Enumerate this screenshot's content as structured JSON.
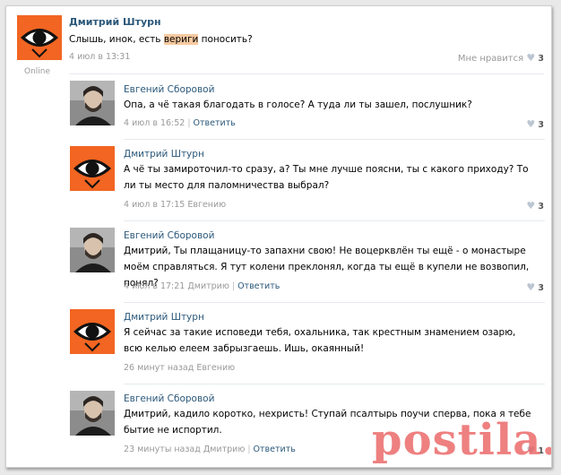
{
  "main_post": {
    "author": "Дмитрий Штурн",
    "status": "Online",
    "text_before": "Слышь, инок, есть ",
    "text_highlight": "вериги",
    "text_after": " поносить?",
    "timestamp": "4 июл в 13:31",
    "like_label": "Мне нравится",
    "likes": "3",
    "avatar_icon": "eye-logo-icon"
  },
  "comments": [
    {
      "author": "Евгений Сборовой",
      "text": "Опа, а чё такая благодать в голосе? А туда ли ты зашел, послушник?",
      "timestamp": "4 июл в 16:52",
      "reply_to": "",
      "reply_label": "Ответить",
      "likes": "3"
    },
    {
      "author": "Дмитрий Штурн",
      "text": "А чё ты замироточил-то сразу, а? Ты мне лучше поясни, ты с какого приходу? То ли ты место для паломничества выбрал?",
      "timestamp": "4 июл в 17:15",
      "reply_to": "Евгению",
      "reply_label": "",
      "likes": "3"
    },
    {
      "author": "Евгений Сборовой",
      "text": "Дмитрий, Ты плащаницу-то запахни свою! Не воцерквлён ты ещё - о монастыре моём справляться. Я тут колени преклонял, когда ты ещё в купели не возвопил, понял?",
      "timestamp": "4 июл в 17:21",
      "reply_to": "Дмитрию",
      "reply_label": "Ответить",
      "likes": "3"
    },
    {
      "author": "Дмитрий Штурн",
      "text": "Я сейчас за такие исповеди тебя, охальника, так крестным знамением озарю, всю келью елеем забрызгаешь. Ишь, окаянный!",
      "timestamp": "26 минут назад",
      "reply_to": "Евгению",
      "reply_label": "",
      "likes": ""
    },
    {
      "author": "Евгений Сборовой",
      "text": "Дмитрий, кадило коротко, нехристь! Ступай псалтырь поучи сперва, пока я тебе бытие не испортил.",
      "timestamp": "23 минуты назад",
      "reply_to": "Дмитрию",
      "reply_label": "Ответить",
      "likes": "1"
    }
  ],
  "watermark": "postila.ru",
  "colors": {
    "link": "#2b587a",
    "avatar_orange": "#f26522",
    "watermark": "#e95c5c"
  }
}
